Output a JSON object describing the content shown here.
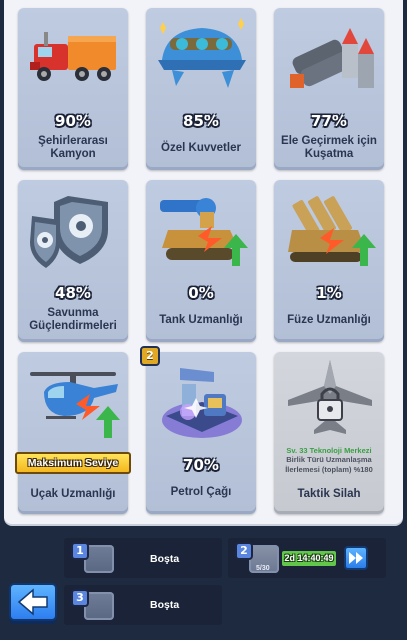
{
  "cards": [
    {
      "name": "Şehirlerarası Kamyon",
      "percent": "90%",
      "icon": "truck-icon"
    },
    {
      "name": "Özel Kuvvetler",
      "percent": "85%",
      "icon": "helmet-icon"
    },
    {
      "name": "Ele Geçirmek için Kuşatma",
      "percent": "77%",
      "icon": "shells-icon"
    },
    {
      "name": "Savunma Güçlendirmeleri",
      "percent": "48%",
      "icon": "gear-shields-icon"
    },
    {
      "name": "Tank Uzmanlığı",
      "percent": "0%",
      "icon": "tank-icon"
    },
    {
      "name": "Füze Uzmanlığı",
      "percent": "1%",
      "icon": "missile-launcher-icon"
    },
    {
      "name": "Uçak Uzmanlığı",
      "status": "Maksimum Seviye",
      "icon": "helicopter-icon"
    },
    {
      "name": "Petrol Çağı",
      "percent": "70%",
      "badge": "2",
      "icon": "oil-pump-icon"
    },
    {
      "name": "Taktik Silah",
      "icon": "locked-jet-icon",
      "lock_lines": [
        "Sv. 33 Teknoloji Merkezi",
        "Birlik Türü Uzmanlaşma",
        "İlerlemesi (toplam) %180"
      ]
    }
  ],
  "queue": [
    {
      "slot": "1",
      "label": "Boşta"
    },
    {
      "slot": "2",
      "count": "5/30",
      "timer": "2d 14:40:49"
    },
    {
      "slot": "3",
      "label": "Boşta"
    }
  ],
  "colors": {
    "accent_blue": "#2d7ef0",
    "progress_green": "#62c64a",
    "gold": "#f4b81e"
  }
}
